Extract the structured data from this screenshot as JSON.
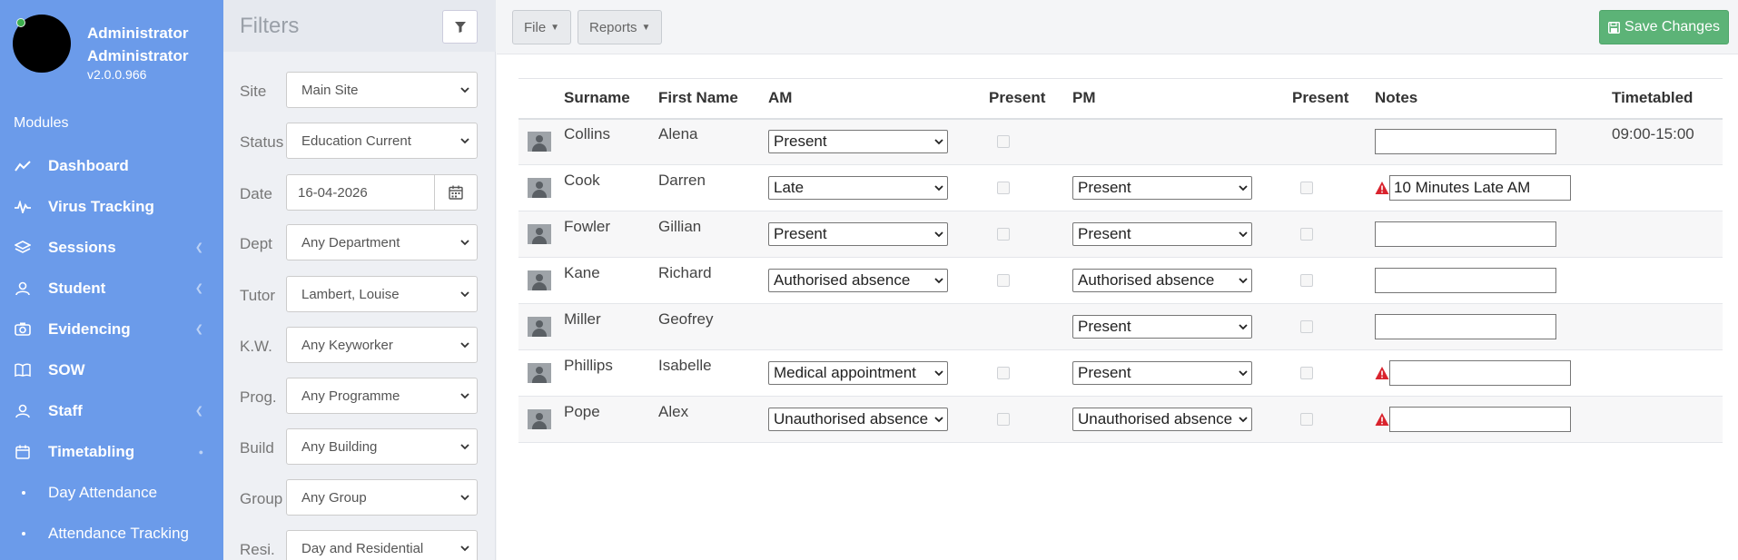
{
  "user": {
    "name": "Administrator Administrator",
    "version": "v2.0.0.966"
  },
  "sidebar": {
    "modules_heading": "Modules",
    "items": [
      {
        "label": "Dashboard",
        "icon": "chart-line-icon"
      },
      {
        "label": "Virus Tracking",
        "icon": "heartbeat-icon"
      },
      {
        "label": "Sessions",
        "icon": "layers-icon"
      },
      {
        "label": "Student",
        "icon": "user-icon"
      },
      {
        "label": "Evidencing",
        "icon": "camera-icon"
      },
      {
        "label": "SOW",
        "icon": "book-icon"
      },
      {
        "label": "Staff",
        "icon": "user-icon"
      },
      {
        "label": "Timetabling",
        "icon": "calendar-icon"
      }
    ],
    "subitems": [
      {
        "label": "Day Attendance"
      },
      {
        "label": "Attendance Tracking"
      }
    ]
  },
  "filters": {
    "title": "Filters",
    "rows": [
      {
        "label": "Site",
        "value": "Main Site"
      },
      {
        "label": "Status",
        "value": "Education Current"
      },
      {
        "label": "Date",
        "value": "16-04-2026"
      },
      {
        "label": "Dept",
        "value": "Any Department"
      },
      {
        "label": "Tutor",
        "value": "Lambert, Louise"
      },
      {
        "label": "K.W.",
        "value": "Any Keyworker"
      },
      {
        "label": "Prog.",
        "value": "Any Programme"
      },
      {
        "label": "Build",
        "value": "Any Building"
      },
      {
        "label": "Group",
        "value": "Any Group"
      },
      {
        "label": "Resi.",
        "value": "Day and Residential"
      }
    ]
  },
  "toolbar": {
    "file_label": "File",
    "reports_label": "Reports",
    "save_label": "Save Changes"
  },
  "table": {
    "headers": {
      "surname": "Surname",
      "first_name": "First Name",
      "am": "AM",
      "present_am": "Present",
      "pm": "PM",
      "present_pm": "Present",
      "notes": "Notes",
      "timetabled": "Timetabled"
    },
    "rows": [
      {
        "surname": "Collins",
        "first_name": "Alena",
        "am": "Present",
        "pm": "",
        "note": "",
        "warning": false,
        "timetabled": "09:00-15:00"
      },
      {
        "surname": "Cook",
        "first_name": "Darren",
        "am": "Late",
        "pm": "Present",
        "note": "10 Minutes Late AM",
        "warning": true,
        "timetabled": ""
      },
      {
        "surname": "Fowler",
        "first_name": "Gillian",
        "am": "Present",
        "pm": "Present",
        "note": "",
        "warning": false,
        "timetabled": ""
      },
      {
        "surname": "Kane",
        "first_name": "Richard",
        "am": "Authorised absence",
        "pm": "Authorised absence",
        "note": "",
        "warning": false,
        "timetabled": ""
      },
      {
        "surname": "Miller",
        "first_name": "Geofrey",
        "am": "",
        "pm": "Present",
        "note": "",
        "warning": false,
        "timetabled": ""
      },
      {
        "surname": "Phillips",
        "first_name": "Isabelle",
        "am": "Medical appointment",
        "pm": "Present",
        "note": "",
        "warning": true,
        "timetabled": ""
      },
      {
        "surname": "Pope",
        "first_name": "Alex",
        "am": "Unauthorised absence",
        "pm": "Unauthorised absence",
        "note": "",
        "warning": true,
        "timetabled": ""
      }
    ]
  },
  "colors": {
    "sidebar": "#6b9bea",
    "save_button": "#5cb377",
    "warning": "#d9232d"
  }
}
